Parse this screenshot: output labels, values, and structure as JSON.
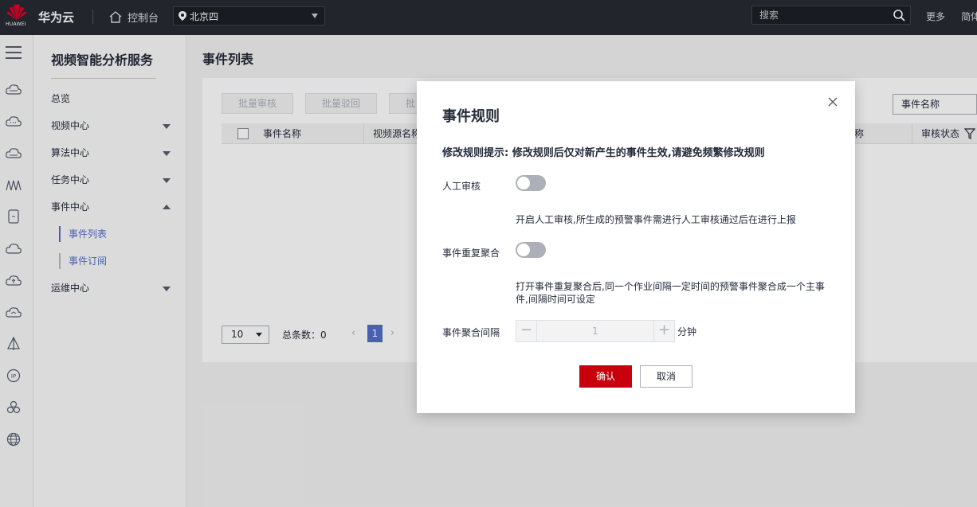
{
  "topbar": {
    "logo_text": "HUAWEI",
    "brand": "华为云",
    "console": "控制台",
    "region": "北京四",
    "search_placeholder": "搜索",
    "more": "更多",
    "lang": "简体"
  },
  "rail": {
    "icons": [
      "menu-icon",
      "cloud-server-icon",
      "cloud-icon",
      "cloud-storage-icon",
      "network-icon",
      "device-icon",
      "cloud-outline-icon",
      "cloud-upload-icon",
      "cloud-download-icon",
      "triangle-icon",
      "ip-icon",
      "cluster-icon",
      "globe-icon"
    ]
  },
  "nav": {
    "title": "视频智能分析服务",
    "items": [
      {
        "label": "总览"
      },
      {
        "label": "视频中心"
      },
      {
        "label": "算法中心"
      },
      {
        "label": "任务中心"
      },
      {
        "label": "事件中心"
      },
      {
        "label": "运维中心"
      }
    ],
    "sub_items": [
      {
        "label": "事件列表"
      },
      {
        "label": "事件订阅"
      }
    ]
  },
  "main": {
    "title": "事件列表",
    "buttons": {
      "batch_audit": "批量审核",
      "batch_reject": "批量驳回",
      "batch_third": "批"
    },
    "search_select": "事件名称",
    "columns": [
      "事件名称",
      "视频源名称",
      "称",
      "审核状态"
    ],
    "pagination": {
      "page_size": "10",
      "total_label": "总条数：0",
      "current_page": "1",
      "prev": "‹",
      "next": "›"
    }
  },
  "dialog": {
    "title": "事件规则",
    "hint": "修改规则提示: 修改规则后仅对新产生的事件生效,请避免频繁修改规则",
    "manual_review_label": "人工审核",
    "manual_review_on": false,
    "manual_review_desc": "开启人工审核,所生成的预警事件需进行人工审核通过后在进行上报",
    "aggregate_label": "事件重复聚合",
    "aggregate_on": false,
    "aggregate_desc_line1": "打开事件重复聚合后,同一个作业间隔一定时间的预警事件聚合成一个主事",
    "aggregate_desc_line2": "件,间隔时间可设定",
    "interval_label": "事件聚合间隔",
    "interval_value": "1",
    "interval_unit": "分钟",
    "minus": "−",
    "plus": "+",
    "confirm": "确认",
    "cancel": "取消"
  },
  "colors": {
    "brand_red": "#c7000b",
    "accent_blue": "#526ecc",
    "topbar": "#272b33"
  }
}
